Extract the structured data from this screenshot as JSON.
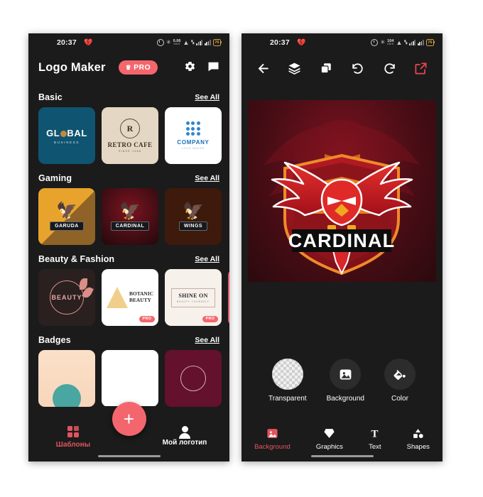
{
  "statusbar": {
    "time": "20:37",
    "heart_icon": "broken-heart-icon",
    "alarm_icon": "alarm-icon",
    "bluetooth_icon": "bluetooth-icon",
    "data_speed_value": "0.06",
    "data_speed_unit": "KB/S",
    "wifi_icon": "wifi-icon",
    "battery_level": "76"
  },
  "left_phone": {
    "appbar": {
      "title": "Logo Maker",
      "pro_label": "PRO",
      "crown_icon": "crown-icon",
      "settings_icon": "gear-icon",
      "feedback_icon": "chat-icon"
    },
    "see_all_label": "See All",
    "sections": [
      {
        "title": "Basic",
        "cards": [
          {
            "name": "global-business",
            "line1": "GL",
            "line1b": "BAL",
            "line2": "BUSINESS"
          },
          {
            "name": "retro-cafe",
            "mono": "R",
            "line1": "RETRO CAFE",
            "line2": "SINCE 1968"
          },
          {
            "name": "company-logo-maker",
            "line1": "COMPANY",
            "line2": "LOGO MAKER"
          }
        ]
      },
      {
        "title": "Gaming",
        "cards": [
          {
            "name": "garuda",
            "label": "GARUDA"
          },
          {
            "name": "cardinal",
            "label": "CARDINAL"
          },
          {
            "name": "wings",
            "label": "WINGS"
          }
        ]
      },
      {
        "title": "Beauty & Fashion",
        "cards": [
          {
            "name": "beauty",
            "label": "BEAUTY",
            "pro": ""
          },
          {
            "name": "botanic-beauty",
            "line1": "BOTANIC",
            "line2": "BEAUTY",
            "pro": "PRO"
          },
          {
            "name": "shine-on",
            "line1": "SHINE ON",
            "line2": "BEAUTY YOURSELF",
            "pro": "PRO"
          }
        ]
      },
      {
        "title": "Badges",
        "cards": [
          {
            "name": "badge-peach"
          },
          {
            "name": "badge-white"
          },
          {
            "name": "badge-maroon"
          }
        ]
      }
    ],
    "bottom_nav": [
      {
        "label": "Шаблоны",
        "icon": "grid-icon",
        "active": true
      },
      {
        "label": "Мой логотип",
        "icon": "person-icon",
        "active": false
      }
    ],
    "fab_label": "+"
  },
  "right_phone": {
    "toolbar": [
      {
        "name": "back",
        "icon": "arrow-left-icon",
        "glyph": "←"
      },
      {
        "name": "layers",
        "icon": "layers-icon",
        "glyph": ""
      },
      {
        "name": "duplicate",
        "icon": "duplicate-icon",
        "glyph": ""
      },
      {
        "name": "undo",
        "icon": "undo-icon",
        "glyph": "↺"
      },
      {
        "name": "redo",
        "icon": "redo-icon",
        "glyph": "↻"
      },
      {
        "name": "export",
        "icon": "export-icon",
        "glyph": ""
      }
    ],
    "canvas": {
      "logo_text": "CARDINAL"
    },
    "options": [
      {
        "label": "Transparent",
        "icon": "transparent-checker-icon"
      },
      {
        "label": "Background",
        "icon": "image-icon"
      },
      {
        "label": "Color",
        "icon": "paint-bucket-icon"
      }
    ],
    "tabs": [
      {
        "label": "Background",
        "icon": "image-icon",
        "active": true
      },
      {
        "label": "Graphics",
        "icon": "diamond-icon",
        "active": false
      },
      {
        "label": "Text",
        "icon": "text-icon",
        "active": false
      },
      {
        "label": "Shapes",
        "icon": "shapes-icon",
        "active": false
      }
    ]
  },
  "colors": {
    "accent": "#e2545e",
    "pro": "#f4666d",
    "export": "#ef4452",
    "phone_bg": "#1b1b1b",
    "page_bg": "#ffffff"
  }
}
